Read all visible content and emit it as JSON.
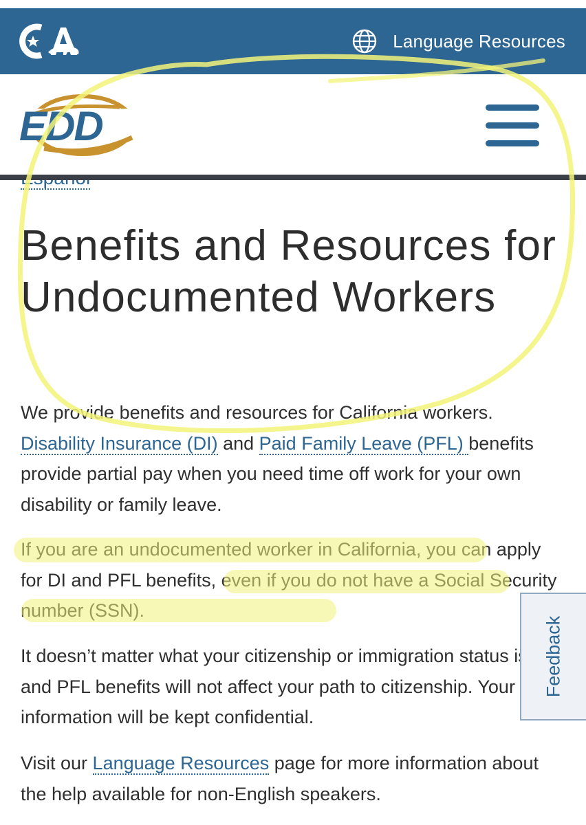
{
  "ca_bar": {
    "logo_text": "CA",
    "language_link": "Language Resources",
    "globe_icon": "globe-icon"
  },
  "header": {
    "logo_text": "EDD",
    "menu_icon": "hamburger-menu-icon"
  },
  "espanol_link": "Español",
  "page_title": "Benefits and Resources for Undocumented Workers",
  "paragraph1": {
    "intro": "We provide benefits and resources for California workers.",
    "link_di": "Disability Insurance (DI)",
    "and": " and ",
    "link_pfl": "Paid Family Leave (PFL) ",
    "rest": "benefits provide partial pay when you need time off work for your own disability or family leave."
  },
  "paragraph2": "If you are an undocumented worker in California, you can apply for DI and PFL benefits, even if you do not have a Social Security number (SSN).",
  "paragraph3": "It doesn’t matter what your citizenship or immigration status is; DI and PFL benefits will not affect your path to citizenship. Your information will be kept confidential.",
  "paragraph4": {
    "before": "Visit our ",
    "link": "Language Resources",
    "after": " page for more information about the help available for non-English speakers."
  },
  "feedback_tab": "Feedback",
  "colors": {
    "brand_blue": "#2d6593",
    "edd_gold": "#c8922e",
    "highlighter": "#f3f37a"
  }
}
